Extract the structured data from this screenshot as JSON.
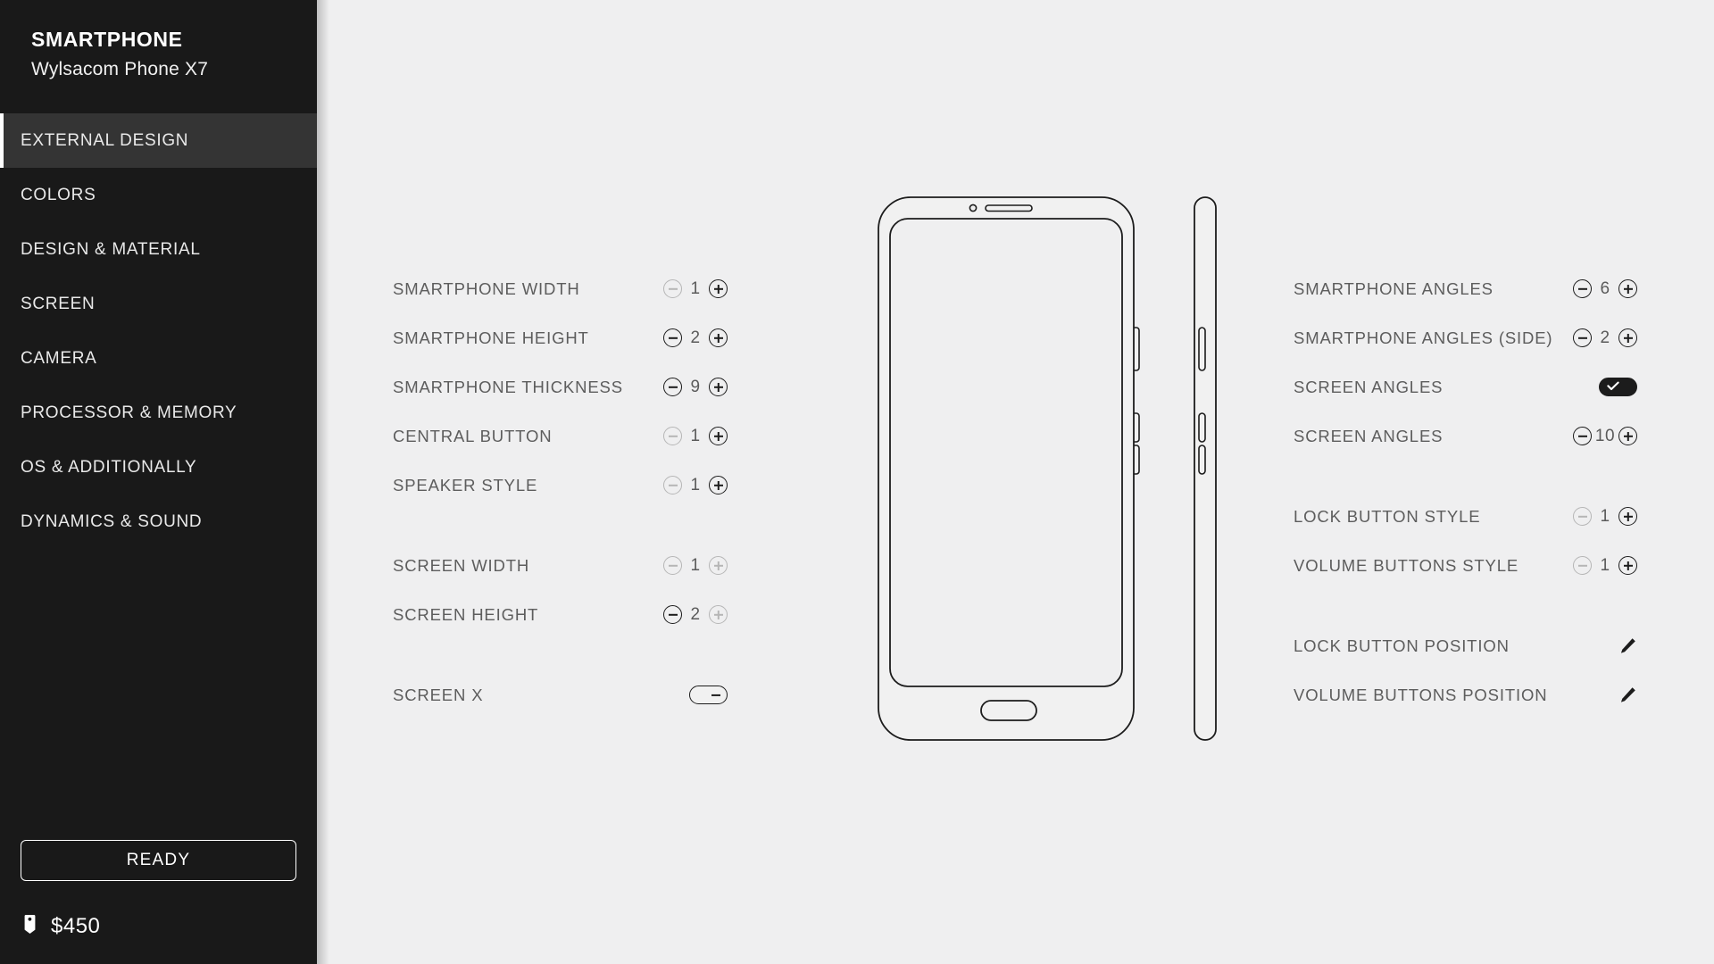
{
  "sidebar": {
    "brand_title": "SMARTPHONE",
    "brand_subtitle": "Wylsacom Phone X7",
    "items": [
      {
        "label": "EXTERNAL DESIGN",
        "active": true
      },
      {
        "label": "COLORS",
        "active": false
      },
      {
        "label": "DESIGN & MATERIAL",
        "active": false
      },
      {
        "label": "SCREEN",
        "active": false
      },
      {
        "label": "CAMERA",
        "active": false
      },
      {
        "label": "PROCESSOR & MEMORY",
        "active": false
      },
      {
        "label": "OS & ADDITIONALLY",
        "active": false
      },
      {
        "label": "DYNAMICS & SOUND",
        "active": false
      }
    ],
    "ready_label": "READY",
    "price": "$450",
    "price_icon": "price-tag-icon"
  },
  "left_panel": {
    "rows": [
      {
        "label": "SMARTPHONE WIDTH",
        "type": "stepper",
        "value": "1",
        "minus_enabled": false,
        "plus_enabled": true,
        "gap_before": false
      },
      {
        "label": "SMARTPHONE HEIGHT",
        "type": "stepper",
        "value": "2",
        "minus_enabled": true,
        "plus_enabled": true,
        "gap_before": false
      },
      {
        "label": "SMARTPHONE THICKNESS",
        "type": "stepper",
        "value": "9",
        "minus_enabled": true,
        "plus_enabled": true,
        "gap_before": false
      },
      {
        "label": "CENTRAL BUTTON",
        "type": "stepper",
        "value": "1",
        "minus_enabled": false,
        "plus_enabled": true,
        "gap_before": false
      },
      {
        "label": "SPEAKER STYLE",
        "type": "stepper",
        "value": "1",
        "minus_enabled": false,
        "plus_enabled": true,
        "gap_before": false
      },
      {
        "label": "SCREEN WIDTH",
        "type": "stepper",
        "value": "1",
        "minus_enabled": false,
        "plus_enabled": false,
        "gap_before": true
      },
      {
        "label": "SCREEN HEIGHT",
        "type": "stepper",
        "value": "2",
        "minus_enabled": true,
        "plus_enabled": false,
        "gap_before": false
      },
      {
        "label": "SCREEN X",
        "type": "toggle",
        "toggle_on": false,
        "gap_before": true
      }
    ]
  },
  "right_panel": {
    "rows": [
      {
        "label": "SMARTPHONE ANGLES",
        "type": "stepper",
        "value": "6",
        "minus_enabled": true,
        "plus_enabled": true,
        "gap_before": false
      },
      {
        "label": "SMARTPHONE ANGLES (SIDE)",
        "type": "stepper",
        "value": "2",
        "minus_enabled": true,
        "plus_enabled": true,
        "gap_before": false
      },
      {
        "label": "SCREEN ANGLES",
        "type": "toggle",
        "toggle_on": true,
        "gap_before": false
      },
      {
        "label": "SCREEN ANGLES",
        "type": "stepper",
        "value": "10",
        "minus_enabled": true,
        "plus_enabled": true,
        "gap_before": false
      },
      {
        "label": "LOCK BUTTON STYLE",
        "type": "stepper",
        "value": "1",
        "minus_enabled": false,
        "plus_enabled": true,
        "gap_before": true
      },
      {
        "label": "VOLUME BUTTONS STYLE",
        "type": "stepper",
        "value": "1",
        "minus_enabled": false,
        "plus_enabled": true,
        "gap_before": false
      },
      {
        "label": "LOCK BUTTON POSITION",
        "type": "edit",
        "icon": "pencil-icon",
        "gap_before": true
      },
      {
        "label": "VOLUME BUTTONS POSITION",
        "type": "edit",
        "icon": "pencil-icon",
        "gap_before": false
      }
    ]
  },
  "preview": {
    "front_view_name": "phone-front-view",
    "side_view_name": "phone-side-view",
    "features": [
      "camera",
      "speaker",
      "screen",
      "central-button",
      "lock-button",
      "volume-buttons"
    ]
  },
  "colors": {
    "background": "#efeff0",
    "sidebar": "#191919",
    "sidebar_active": "#343434",
    "accent": "#ffffff",
    "label_text": "#5d5d5d",
    "control_enabled": "#1c1c1c",
    "control_disabled": "#b6b6b6",
    "outline": "#1c1c1c"
  }
}
